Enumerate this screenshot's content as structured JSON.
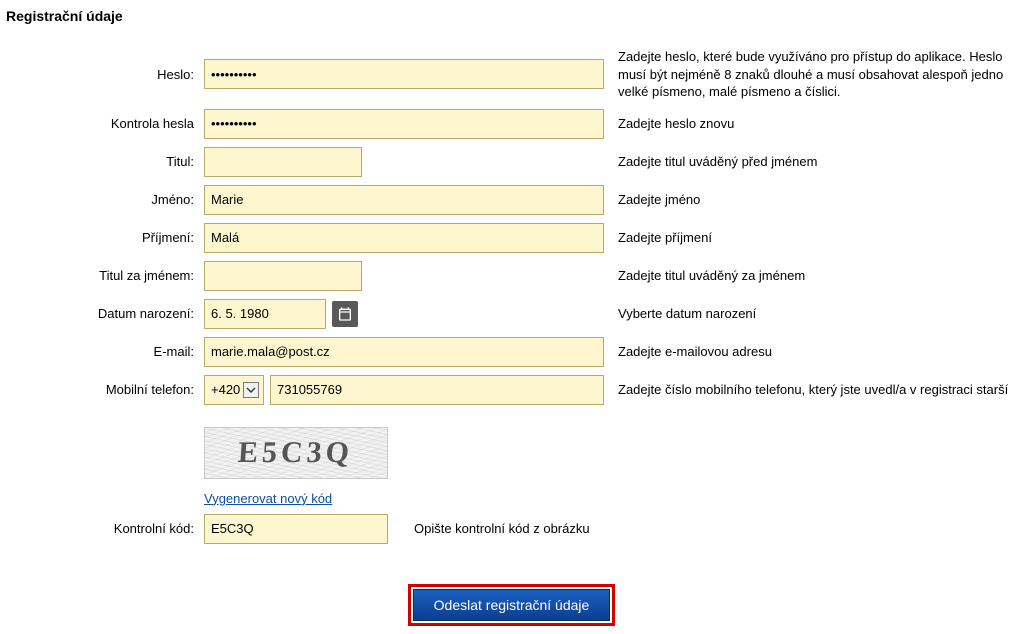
{
  "heading": "Registrační údaje",
  "labels": {
    "heslo": "Heslo:",
    "kontrola": "Kontrola hesla",
    "titul": "Titul:",
    "jmeno": "Jméno:",
    "prijmeni": "Příjmení:",
    "titulZa": "Titul za jménem:",
    "datum": "Datum narození:",
    "email": "E-mail:",
    "mobil": "Mobilní telefon:",
    "kod": "Kontrolní kód:"
  },
  "values": {
    "heslo": "••••••••••",
    "kontrola": "••••••••••",
    "titul": "",
    "jmeno": "Marie",
    "prijmeni": "Malá",
    "titulZa": "",
    "datum": "6. 5. 1980",
    "email": "marie.mala@post.cz",
    "prefix": "+420",
    "mobil": "731055769",
    "captchaShown": "E5C3Q",
    "kod": "E5C3Q"
  },
  "help": {
    "heslo": "Zadejte heslo, které bude využíváno pro přístup do aplikace. Heslo musí být nejméně 8 znaků dlouhé a musí obsahovat alespoň jedno velké písmeno, malé písmeno a číslici.",
    "kontrola": "Zadejte heslo znovu",
    "titul": "Zadejte titul uváděný před jménem",
    "jmeno": "Zadejte jméno",
    "prijmeni": "Zadejte příjmení",
    "titulZa": "Zadejte titul uváděný za jménem",
    "datum": "Vyberte datum narození",
    "email": "Zadejte e-mailovou adresu",
    "mobil": "Zadejte číslo mobilního telefonu, který jste uvedl/a v registraci starší",
    "kod": "Opište kontrolní kód z obrázku"
  },
  "links": {
    "regen": "Vygenerovat nový kód"
  },
  "buttons": {
    "submit": "Odeslat registrační údaje"
  }
}
